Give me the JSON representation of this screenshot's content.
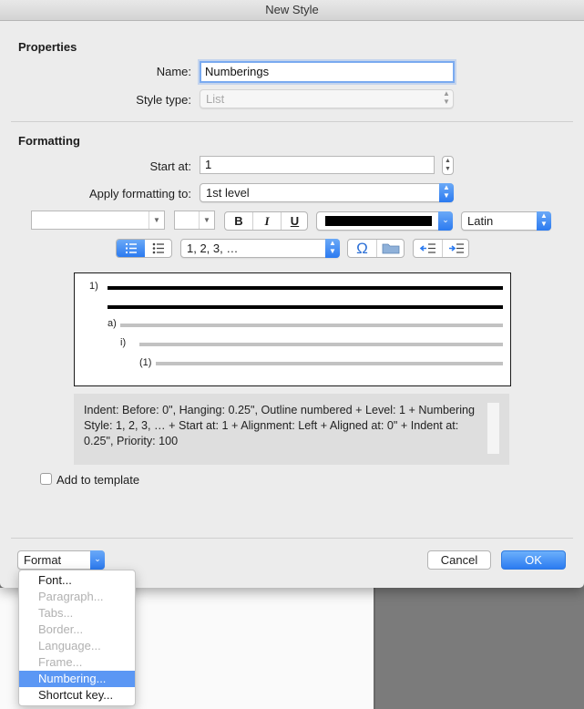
{
  "window": {
    "title": "New Style"
  },
  "properties": {
    "heading": "Properties",
    "name_label": "Name:",
    "name_value": "Numberings",
    "style_type_label": "Style type:",
    "style_type_value": "List"
  },
  "formatting": {
    "heading": "Formatting",
    "start_at_label": "Start at:",
    "start_at_value": "1",
    "apply_label": "Apply formatting to:",
    "apply_value": "1st level",
    "font_name": "",
    "font_size": "",
    "bold": "B",
    "italic": "I",
    "underline": "U",
    "font_color": "#000000",
    "script_value": "Latin",
    "number_style_value": "1, 2, 3, …",
    "symbol_glyph": "Ω"
  },
  "preview": {
    "levels": [
      {
        "label": "1)"
      },
      {
        "label": "a)"
      },
      {
        "label": "i)"
      },
      {
        "label": "(1)"
      }
    ]
  },
  "description": {
    "text": "Indent: Before:  0\", Hanging:  0.25\", Outline numbered + Level: 1 + Numbering Style: 1, 2, 3, … + Start at: 1 + Alignment: Left + Aligned at:  0\" + Indent at:  0.25\", Priority: 100"
  },
  "add_to_template_label": "Add to template",
  "add_to_template_checked": false,
  "footer": {
    "format_label": "Format",
    "cancel_label": "Cancel",
    "ok_label": "OK"
  },
  "format_menu": {
    "items": [
      {
        "label": "Font...",
        "enabled": true,
        "selected": false
      },
      {
        "label": "Paragraph...",
        "enabled": false,
        "selected": false
      },
      {
        "label": "Tabs...",
        "enabled": false,
        "selected": false
      },
      {
        "label": "Border...",
        "enabled": false,
        "selected": false
      },
      {
        "label": "Language...",
        "enabled": false,
        "selected": false
      },
      {
        "label": "Frame...",
        "enabled": false,
        "selected": false
      },
      {
        "label": "Numbering...",
        "enabled": true,
        "selected": true
      },
      {
        "label": "Shortcut key...",
        "enabled": true,
        "selected": false
      }
    ]
  },
  "colors": {
    "accent": "#2b7af0",
    "selection": "#5b97f4"
  }
}
